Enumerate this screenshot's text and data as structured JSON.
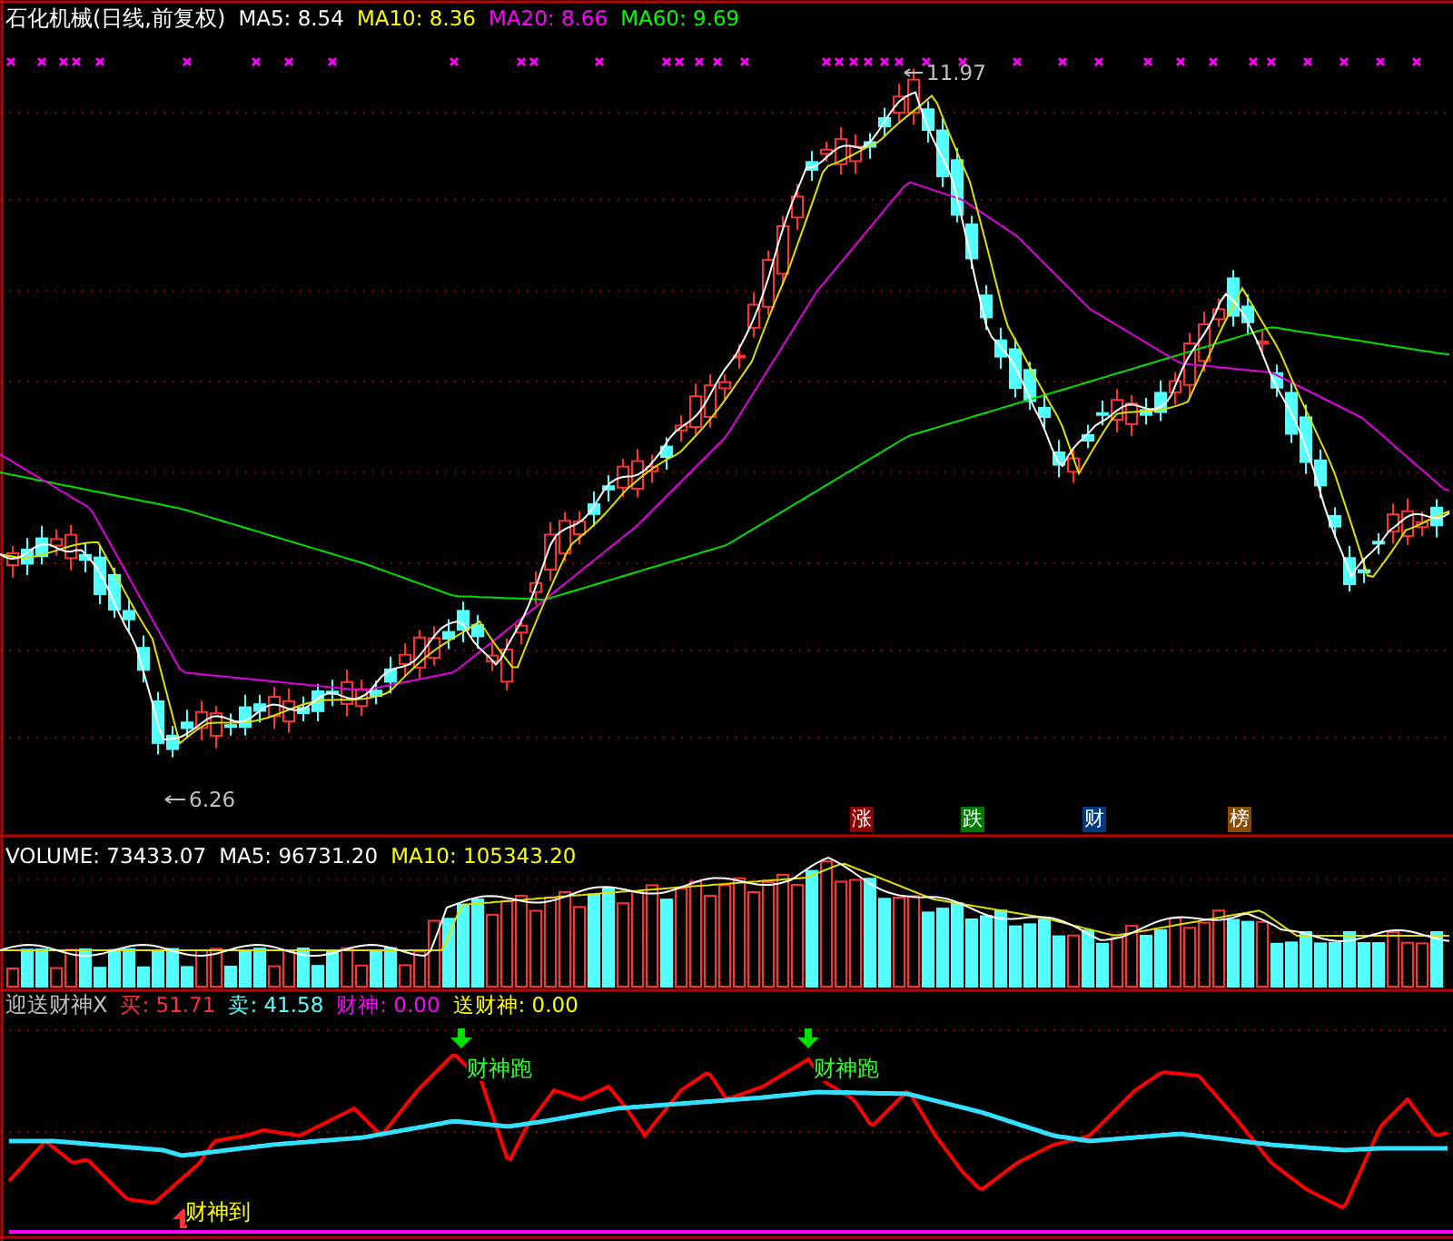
{
  "price_panel": {
    "title": "石化机械(日线,前复权)",
    "indicators": [
      {
        "label": "MA5: 8.54",
        "color": "#ffffff"
      },
      {
        "label": "MA10: 8.36",
        "color": "#ffff00"
      },
      {
        "label": "MA20: 8.66",
        "color": "#ff00ff"
      },
      {
        "label": "MA60: 9.69",
        "color": "#00ff00"
      }
    ],
    "high_label": "11.97",
    "low_label": "6.26",
    "badges": [
      {
        "text": "涨",
        "color": "#8b0000"
      },
      {
        "text": "跌",
        "color": "#007a00"
      },
      {
        "text": "财",
        "color": "#003a80"
      },
      {
        "text": "榜",
        "color": "#8b4a00"
      }
    ]
  },
  "volume_panel": {
    "indicators": [
      {
        "label": "VOLUME: 73433.07",
        "color": "#ffffff"
      },
      {
        "label": "MA5: 96731.20",
        "color": "#ffffff"
      },
      {
        "label": "MA10: 105343.20",
        "color": "#ffff00"
      }
    ]
  },
  "indicator_panel": {
    "title": "迎送财神X",
    "indicators": [
      {
        "label": "买: 51.71",
        "color": "#ff3030"
      },
      {
        "label": "卖: 41.58",
        "color": "#55ffff"
      },
      {
        "label": "财神: 0.00",
        "color": "#ff00ff"
      },
      {
        "label": "送财神: 0.00",
        "color": "#ffff00"
      }
    ],
    "signals": [
      {
        "kind": "sell",
        "text": "财神跑"
      },
      {
        "kind": "sell",
        "text": "财神跑"
      },
      {
        "kind": "buy",
        "text": "财神到"
      }
    ]
  }
}
